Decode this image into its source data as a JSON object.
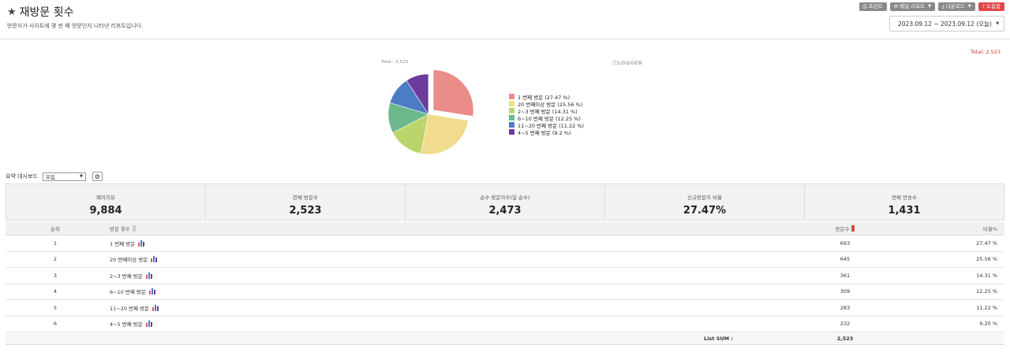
{
  "page": {
    "title": "재방문 횟수",
    "description": "방문자가 사이트에 몇 번 째 방문인지 나타낸 리포트입니다."
  },
  "toolbar": {
    "print_label": "프린트",
    "email_label": "메일 리포트",
    "download_label": "다운로드",
    "help_label": "도움말"
  },
  "date_range": "2023.09.12 ~ 2023.09.12 (오늘)",
  "total_top": "Total: 2,523",
  "chart_header": {
    "pie_total": "Total : 2,523",
    "logo": "ⓛLOGGER"
  },
  "chart_data": {
    "type": "pie",
    "title": "",
    "categories": [
      "1 번째 방문",
      "20 번째이상 방문",
      "2~3 번째 방문",
      "6~10 번째 방문",
      "11~20 번째 방문",
      "4~5 번째 방문"
    ],
    "values": [
      27.47,
      25.56,
      14.31,
      12.25,
      11.22,
      9.2
    ],
    "colors": [
      "#ea8c88",
      "#f0dc8c",
      "#bcd46c",
      "#6cb88c",
      "#4c7cc4",
      "#6c3c9c"
    ],
    "legend_position": "right",
    "exploded_first_slice": true
  },
  "legend": [
    "1 번째 방문  (27.47 %)",
    "20 번째이상 방문  (25.56 %)",
    "2~3 번째 방문  (14.31 %)",
    "6~10 번째 방문  (12.25 %)",
    "11~20 번째 방문  (11.22 %)",
    "4~5 번째 방문  (9.2 %)"
  ],
  "summary_bar": {
    "label": "요약 대시보드",
    "select_value": "유입"
  },
  "stats": [
    {
      "label": "페이지뷰",
      "value": "9,884"
    },
    {
      "label": "전체 방문수",
      "value": "2,523"
    },
    {
      "label": "순수 방문자수(일 순수)",
      "value": "2,473"
    },
    {
      "label": "신규방문자 비율",
      "value": "27.47%"
    },
    {
      "label": "전체 반송수",
      "value": "1,431"
    }
  ],
  "table": {
    "headers": {
      "rank": "순위",
      "name": "방문 횟수",
      "count": "방문수",
      "ratio": "비율%"
    },
    "rows": [
      {
        "rank": "1",
        "name": "1 번째 방문",
        "count": "693",
        "ratio": "27.47 %"
      },
      {
        "rank": "2",
        "name": "20 번째이상 방문",
        "count": "645",
        "ratio": "25.56 %"
      },
      {
        "rank": "3",
        "name": "2~3 번째 방문",
        "count": "361",
        "ratio": "14.31 %"
      },
      {
        "rank": "4",
        "name": "6~10 번째 방문",
        "count": "309",
        "ratio": "12.25 %"
      },
      {
        "rank": "5",
        "name": "11~20 번째 방문",
        "count": "283",
        "ratio": "11.22 %"
      },
      {
        "rank": "6",
        "name": "4~5 번째 방문",
        "count": "232",
        "ratio": "9.20 %"
      }
    ],
    "sum_label": "List SUM :",
    "sum_value": "2,523"
  }
}
